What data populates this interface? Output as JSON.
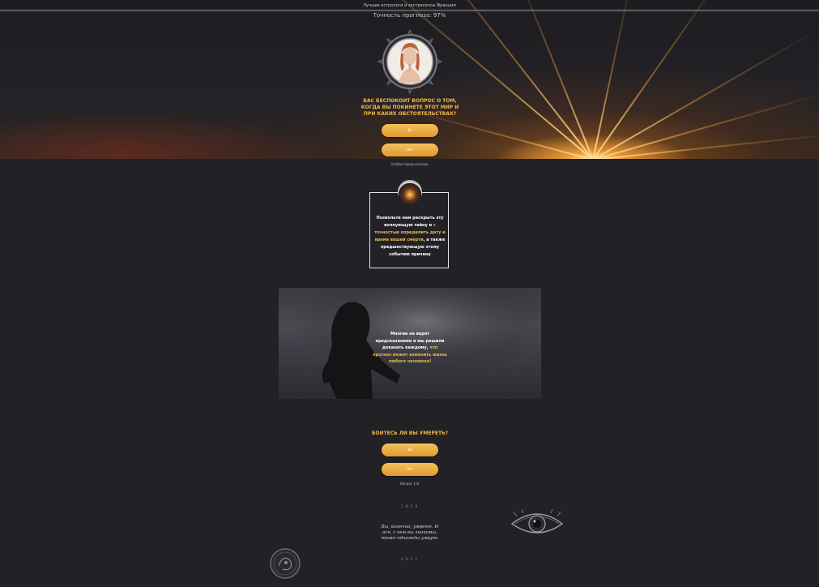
{
  "header": {
    "top_text": "Лучшие астрологи и экстрасенсы Франции",
    "accuracy": "Точность прогноза: 97%"
  },
  "question1": {
    "title": "ВАС БЕСПОКОИТ ВОПРОС О ТОМ, КОГДА ВЫ ПОКИНЕТЕ ЭТОТ МИР И ПРИ КАКИХ ОБСТОЯТЕЛЬСТВАХ?",
    "yes": "Да",
    "no": "Нет",
    "note": "Особое предсказание"
  },
  "infobox": {
    "text_a": "Позвольте нам раскрыть эту волнующую тайну и ",
    "text_b": "с точностью определить дату и время вашей смерти",
    "text_c": ", а также предшествующую этому событию причину"
  },
  "photo": {
    "text_a": "Многие не верят предсказаниям и мы решили доказать каждому,",
    "text_b": " что прогноз может изменить жизнь любого человека!"
  },
  "question2": {
    "title": "БОИТЕСЬ ЛИ ВЫ УМЕРЕТЬ?",
    "yes": "Да",
    "no": "Нет",
    "progress": "Вопрос 1-8"
  },
  "footer": {
    "year_top": "1 8 2 9",
    "quote": "Вы, конечно, умрете. И все, с кем вы знакомы, тоже однажды умрут.",
    "year_bottom": "2 0 2 1"
  },
  "colors": {
    "accent": "#f0b64a",
    "background": "#222125",
    "button": "#e8a83e"
  },
  "icons": [
    "praying-woman-medallion",
    "candle-icon",
    "eye-icon",
    "zodiac-coin-icon"
  ]
}
